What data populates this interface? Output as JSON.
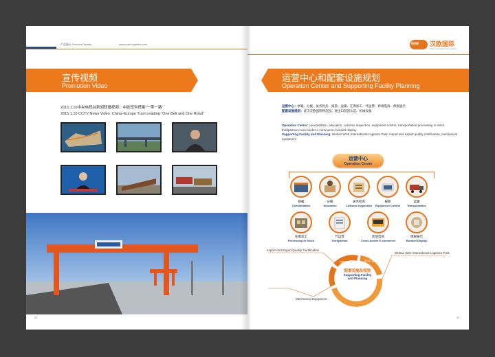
{
  "left_page": {
    "header_left": "产品展示  Product Display",
    "header_url": "www.wae-logistics.com",
    "section_title_cn": "宣传视频",
    "section_title_en": "Promotion Video",
    "captions": [
      "2015.1.10中央电视台新闻联播视频：中欧班列搭乘“一带一路”",
      "2015.1.10 CCTV News Video: China–Europe Train Leading “One Belt and One Road”"
    ],
    "page_number": "53"
  },
  "right_page": {
    "logo": {
      "mark": "WAE",
      "name": "汉欧国际",
      "sub": "Wuhan Asia Europe Logistics"
    },
    "section_title_cn": "运营中心和配套设施规划",
    "section_title_en": "Operation Center and Supporting Facility Planning",
    "cn_text": [
      {
        "label": "运营中心：",
        "text": "拼箱、分拨、关务检务、报管、运输、在库加工、代运营、跨境电商、保税展示"
      },
      {
        "label": "配套设施规划：",
        "text": "武汉汉欧国际物流园、进出口首因认证、机械设备"
      }
    ],
    "en_text": [
      {
        "label": "Operation Center:",
        "text": " consolidation, allocation, customs inspection, equipment control, transportation,processing in stock, thirdpartnar,cross-border e-commerce, bonded display"
      },
      {
        "label": "Supporting Facility and Planning:",
        "text": " Wuhan WAE International Logistics Park, import and export quality certification, mechanical equipment"
      }
    ],
    "operation_center": {
      "title_cn": "运营中心",
      "title_en": "Operation Center",
      "items": [
        {
          "cn": "拼箱",
          "en": "Consolidation"
        },
        {
          "cn": "分拨",
          "en": "Allocation"
        },
        {
          "cn": "关务检务",
          "en": "Customs Inspection"
        },
        {
          "cn": "报管",
          "en": "Equipment Control"
        },
        {
          "cn": "运输",
          "en": "Transportation"
        },
        {
          "cn": "在库加工",
          "en": "Processing In Stock"
        },
        {
          "cn": "代运营",
          "en": "Thirdpartnar"
        },
        {
          "cn": "跨境电商",
          "en": "Cross-border E-commerce"
        },
        {
          "cn": "保税展示",
          "en": "Bonded Display"
        }
      ]
    },
    "facility": {
      "center_cn": "配套设施及规划",
      "center_en": "Supporting Facility and Planning",
      "ring_segments": [
        "进出口首因认证",
        "汉欧国际物流园",
        "机械设备"
      ],
      "labels": {
        "quality": "Import And Export Quality Certification",
        "park": "Wuhan Wae International Logistics Park",
        "mechanical": "Mechanical Equipment"
      }
    },
    "page_number": "54"
  },
  "colors": {
    "accent": "#ec7a1c",
    "navy": "#1d3f7a",
    "bg": "#3c3c3c"
  }
}
